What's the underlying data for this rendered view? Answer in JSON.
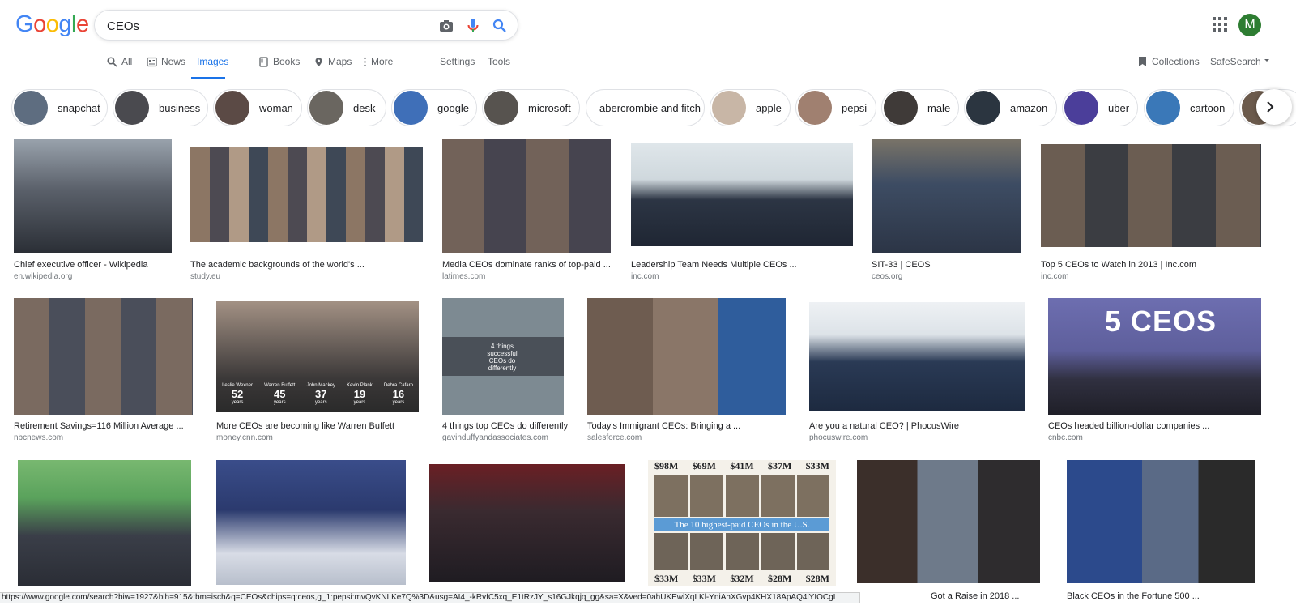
{
  "search": {
    "query": "CEOs"
  },
  "logo": [
    "G",
    "o",
    "o",
    "g",
    "l",
    "e"
  ],
  "logo_colors": [
    "#4285f4",
    "#ea4335",
    "#fbbc05",
    "#4285f4",
    "#34a853",
    "#ea4335"
  ],
  "user": {
    "initial": "M"
  },
  "tabs": [
    {
      "label": "All",
      "icon": "search-icon"
    },
    {
      "label": "News",
      "icon": "news-icon"
    },
    {
      "label": "Images",
      "icon": "image-icon"
    },
    {
      "label": "Books",
      "icon": "book-icon"
    },
    {
      "label": "Maps",
      "icon": "map-pin-icon"
    },
    {
      "label": "More",
      "icon": "more-dots-icon"
    }
  ],
  "tools": {
    "settings": "Settings",
    "tools": "Tools",
    "collections": "Collections",
    "safesearch": "SafeSearch"
  },
  "chips": [
    {
      "label": "snapchat"
    },
    {
      "label": "business"
    },
    {
      "label": "woman"
    },
    {
      "label": "desk"
    },
    {
      "label": "google"
    },
    {
      "label": "microsoft"
    },
    {
      "label": "abercrombie and fitch"
    },
    {
      "label": "apple"
    },
    {
      "label": "pepsi"
    },
    {
      "label": "male"
    },
    {
      "label": "amazon"
    },
    {
      "label": "uber"
    },
    {
      "label": "cartoon"
    },
    {
      "label": ""
    }
  ],
  "results": [
    {
      "title": "Chief executive officer - Wikipedia",
      "site": "en.wikipedia.org",
      "color": "#6b6f77"
    },
    {
      "title": "The academic backgrounds of the world's ...",
      "site": "study.eu",
      "color": "#7a6655"
    },
    {
      "title": "Media CEOs dominate ranks of top-paid ...",
      "site": "latimes.com",
      "color": "#5a4f48"
    },
    {
      "title": "Leadership Team Needs Multiple CEOs ...",
      "site": "inc.com",
      "color": "#2f3a4a"
    },
    {
      "title": "SIT-33 | CEOS",
      "site": "ceos.org",
      "color": "#3d4d63"
    },
    {
      "title": "Top 5 CEOs to Watch in 2013 | Inc.com",
      "site": "inc.com",
      "color": "#5b5650"
    },
    {
      "title": "Retirement Savings=116 Million Average ...",
      "site": "nbcnews.com",
      "color": "#6c5f58"
    },
    {
      "title": "More CEOs are becoming like Warren Buffett",
      "site": "money.cnn.com",
      "color": "#3a3a3a"
    },
    {
      "title": "4 things top CEOs do differently...",
      "site": "gavinduffyandassociates.com",
      "color": "#5a6a74"
    },
    {
      "title": "Today's Immigrant CEOs: Bringing a ...",
      "site": "salesforce.com",
      "color": "#6e5a4c"
    },
    {
      "title": "Are you a natural CEO? | PhocusWire",
      "site": "phocuswire.com",
      "color": "#2c3d58"
    },
    {
      "title": "CEOs headed billion-dollar companies ...",
      "site": "cnbc.com",
      "color": "#6c6da6"
    },
    {
      "title": "",
      "site": "",
      "color": "#3f6b45"
    },
    {
      "title": "",
      "site": "",
      "color": "#2e3f66"
    },
    {
      "title": "",
      "site": "",
      "color": "#2b2730"
    },
    {
      "title": "",
      "site": "",
      "color": "#7b6b52"
    },
    {
      "title": "Got a Raise in 2018 ...",
      "site": "",
      "color": "#4a3b33"
    },
    {
      "title": "Black CEOs in the Fortune 500 ...",
      "site": "",
      "color": "#3b4a66"
    }
  ],
  "result_image_text": {
    "r11_heading": "5 CEOS",
    "r8_caption": "4 things successful CEOs do differently",
    "r7_names": [
      "Leslie Wexner",
      "Warren Buffett",
      "John Mackey",
      "Kevin Plank",
      "Debra Cafaro"
    ],
    "r7_years": [
      "52",
      "45",
      "37",
      "19",
      "16"
    ],
    "r7_unit": "years",
    "r15_amounts": [
      "$98M",
      "$69M",
      "$41M",
      "$37M",
      "$33M",
      "$33M",
      "$33M",
      "$32M",
      "$28M",
      "$28M"
    ],
    "r15_banner": "The 10 highest-paid CEOs in the U.S."
  },
  "status_url": "https://www.google.com/search?biw=1927&bih=915&tbm=isch&q=CEOs&chips=q:ceos,g_1:pepsi:mvQvKNLKe7Q%3D&usg=AI4_-kRvfC5xq_E1tRzJY_s16GJkqjq_gg&sa=X&ved=0ahUKEwiXqLKl-YniAhXGvp4KHX18ApAQ4lYIOCgI"
}
